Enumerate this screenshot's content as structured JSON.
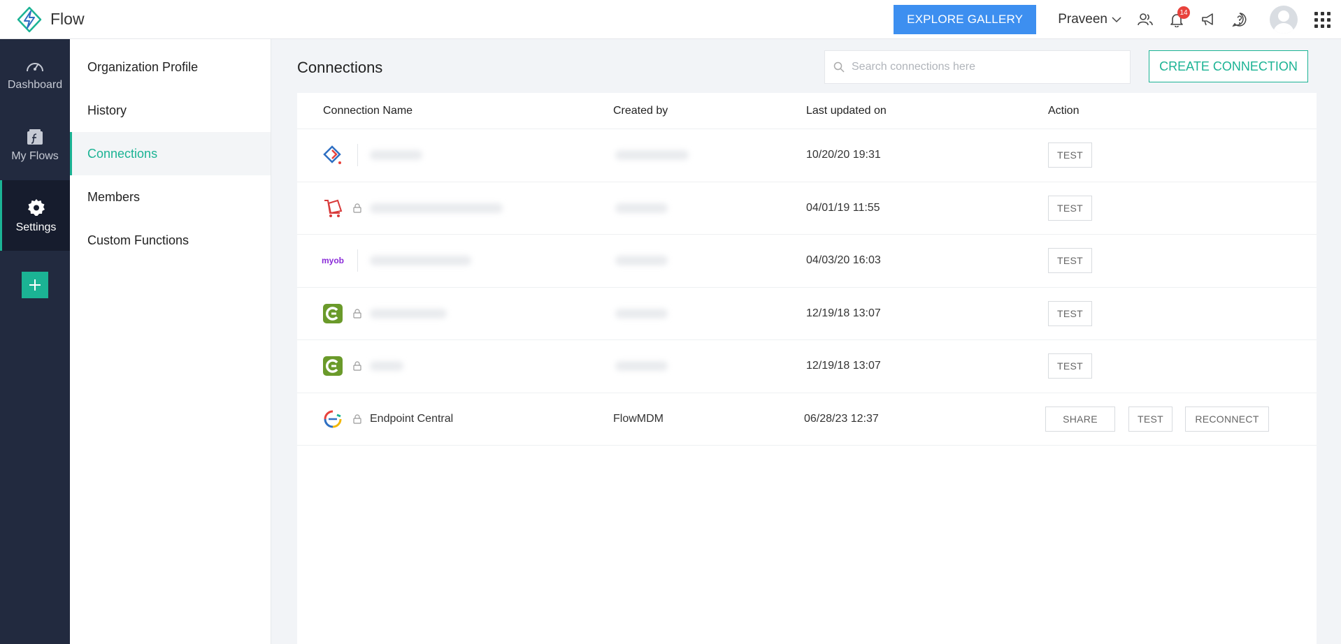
{
  "app": {
    "name": "Flow",
    "logo_icon": "flow-bolt-logo-icon"
  },
  "header": {
    "explore_label": "EXPLORE GALLERY",
    "user_name": "Praveen",
    "notification_count": "14",
    "icons": [
      "users-icon",
      "bell-icon",
      "megaphone-icon",
      "help-icon",
      "avatar",
      "apps-grid-icon"
    ]
  },
  "rail": {
    "items": [
      {
        "label": "Dashboard",
        "icon": "gauge-icon"
      },
      {
        "label": "My Flows",
        "icon": "flows-icon"
      },
      {
        "label": "Settings",
        "icon": "gear-icon",
        "active": true
      }
    ],
    "add_icon": "plus-icon"
  },
  "submenu": {
    "items": [
      {
        "label": "Organization Profile"
      },
      {
        "label": "History"
      },
      {
        "label": "Connections",
        "active": true
      },
      {
        "label": "Members"
      },
      {
        "label": "Custom Functions"
      }
    ]
  },
  "main": {
    "title": "Connections",
    "search_placeholder": "Search connections here",
    "create_label": "CREATE CONNECTION",
    "columns": [
      "Connection Name",
      "Created by",
      "Last updated on",
      "Action"
    ],
    "rows": [
      {
        "icon": "zoho-connector-icon",
        "name": "",
        "created_by": "",
        "updated": "10/20/20 19:31",
        "actions": [
          "TEST"
        ],
        "locked": false
      },
      {
        "icon": "red-cart-icon",
        "name": "",
        "created_by": "",
        "updated": "04/01/19 11:55",
        "actions": [
          "TEST"
        ],
        "locked": true
      },
      {
        "icon": "myob-icon",
        "name": "",
        "created_by": "",
        "updated": "04/03/20 16:03",
        "actions": [
          "TEST"
        ],
        "locked": false
      },
      {
        "icon": "green-c-icon",
        "name": "",
        "created_by": "",
        "updated": "12/19/18 13:07",
        "actions": [
          "TEST"
        ],
        "locked": true
      },
      {
        "icon": "green-c-icon",
        "name": "",
        "created_by": "",
        "updated": "12/19/18 13:07",
        "actions": [
          "TEST"
        ],
        "locked": true
      },
      {
        "icon": "endpoint-central-icon",
        "name": "Endpoint Central",
        "created_by": "FlowMDM",
        "updated": "06/28/23 12:37",
        "actions": [
          "SHARE",
          "TEST",
          "RECONNECT"
        ],
        "locked": true
      }
    ],
    "myob_text": "myob"
  },
  "colors": {
    "accent": "#1bb394",
    "primary_button": "#3d8ff0",
    "rail_bg": "#222a3f",
    "badge": "#e8423c"
  }
}
